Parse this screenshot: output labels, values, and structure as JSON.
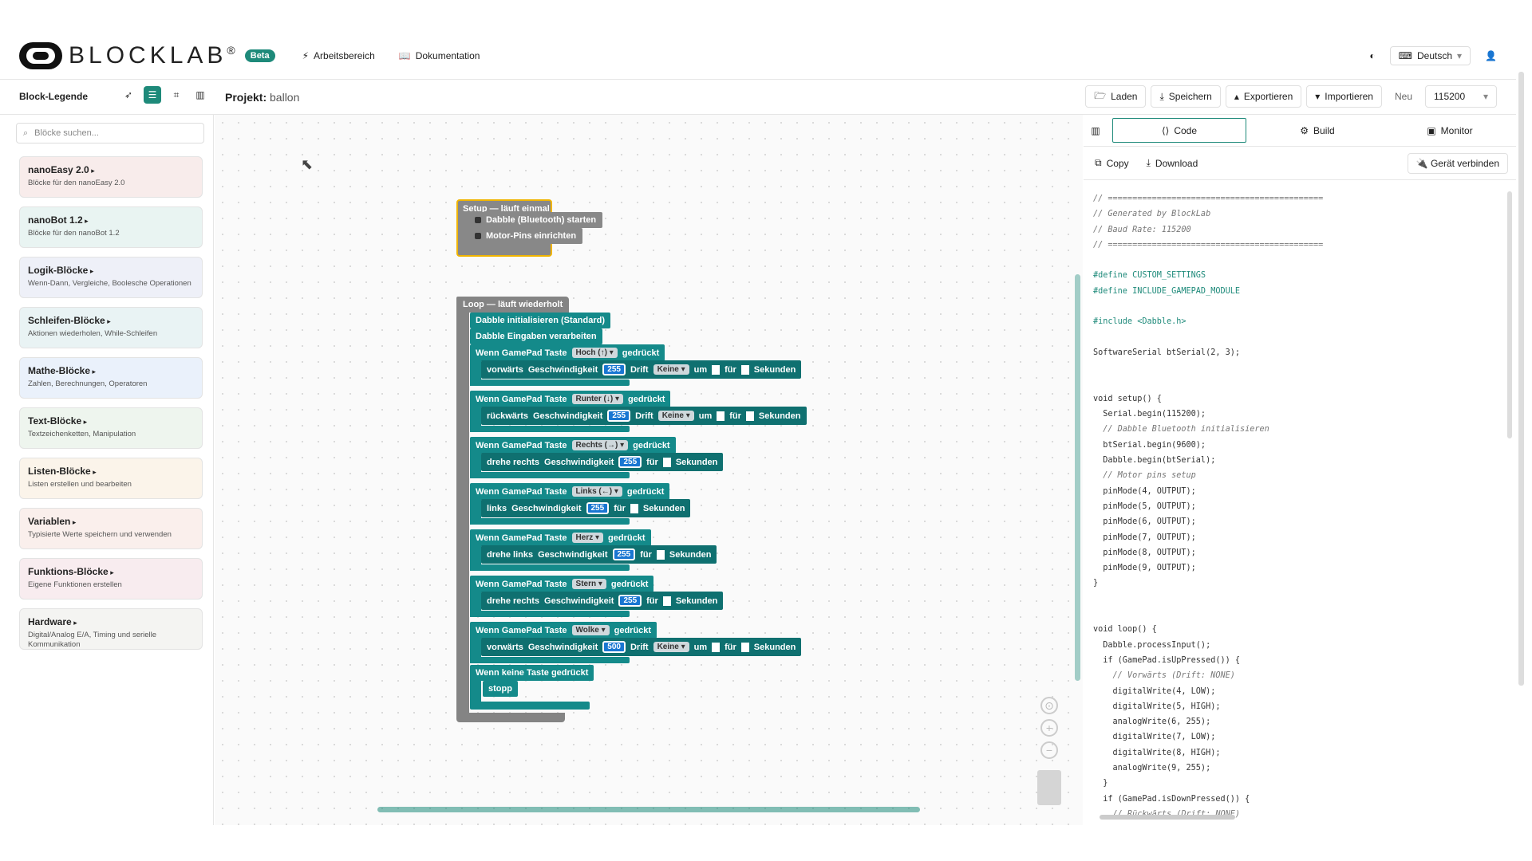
{
  "header": {
    "logo_text": "BLOCKLAB",
    "logo_mark": "®",
    "badge": "Beta",
    "nav": [
      {
        "icon": "bolt-icon",
        "label": "Arbeitsbereich"
      },
      {
        "icon": "book-icon",
        "label": "Dokumentation"
      }
    ],
    "language": "Deutsch"
  },
  "subbar": {
    "legend_title": "Block-Legende",
    "project_label": "Projekt:",
    "project_name": "ballon",
    "actions": {
      "load": "Laden",
      "save": "Speichern",
      "export": "Exportieren",
      "import": "Importieren",
      "new": "Neu",
      "baud": "115200"
    }
  },
  "sidebar": {
    "search_placeholder": "Blöcke suchen...",
    "categories": [
      {
        "title": "nanoEasy 2.0",
        "desc": "Blöcke für den nanoEasy 2.0",
        "color": "#f8eceb"
      },
      {
        "title": "nanoBot 1.2",
        "desc": "Blöcke für den nanoBot 1.2",
        "color": "#e9f4f2"
      },
      {
        "title": "Logik-Blöcke",
        "desc": "Wenn-Dann, Vergleiche, Boolesche Operationen",
        "color": "#eef0f8"
      },
      {
        "title": "Schleifen-Blöcke",
        "desc": "Aktionen wiederholen, While-Schleifen",
        "color": "#e9f3f4"
      },
      {
        "title": "Mathe-Blöcke",
        "desc": "Zahlen, Berechnungen, Operatoren",
        "color": "#eaf1fb"
      },
      {
        "title": "Text-Blöcke",
        "desc": "Textzeichenketten, Manipulation",
        "color": "#eef5ee"
      },
      {
        "title": "Listen-Blöcke",
        "desc": "Listen erstellen und bearbeiten",
        "color": "#fbf4ea"
      },
      {
        "title": "Variablen",
        "desc": "Typisierte Werte speichern und verwenden",
        "color": "#faefec"
      },
      {
        "title": "Funktions-Blöcke",
        "desc": "Eigene Funktionen erstellen",
        "color": "#f8ecef"
      },
      {
        "title": "Hardware",
        "desc": "Digital/Analog E/A, Timing und serielle Kommunikation",
        "color": "#f4f4f2"
      }
    ]
  },
  "workspace": {
    "setup_hat": "Setup — läuft einmal",
    "setup_blocks": [
      "Dabble (Bluetooth) starten",
      "Motor-Pins einrichten"
    ],
    "loop_hat": "Loop — läuft wiederholt",
    "loop_blocks": [
      "Dabble initialisieren (Standard)",
      "Dabble Eingaben verarbeiten"
    ],
    "when_prefix": "Wenn GamePad Taste",
    "when_suffix": "gedrückt",
    "speed_label": "Geschwindigkeit",
    "drift_label": "Drift",
    "drift_value": "Keine",
    "um_label": "um",
    "fuer_label": "für",
    "seconds_label": "Sekunden",
    "events": [
      {
        "button": "Hoch (↑)",
        "action": "vorwärts",
        "speed": "255",
        "drift": true
      },
      {
        "button": "Runter (↓)",
        "action": "rückwärts",
        "speed": "255",
        "drift": true
      },
      {
        "button": "Rechts (→)",
        "action": "drehe rechts",
        "speed": "255",
        "drift": false
      },
      {
        "button": "Links (←)",
        "action": "links",
        "speed": "255",
        "drift": false
      },
      {
        "button": "Herz",
        "action": "drehe links",
        "speed": "255",
        "drift": false
      },
      {
        "button": "Stern",
        "action": "drehe rechts",
        "speed": "255",
        "drift": false
      },
      {
        "button": "Wolke",
        "action": "vorwärts",
        "speed": "500",
        "drift": true
      }
    ],
    "no_key": "Wenn keine Taste gedrückt",
    "stop": "stopp"
  },
  "panel": {
    "tabs": [
      "Code",
      "Build",
      "Monitor"
    ],
    "copy": "Copy",
    "download": "Download",
    "connect": "Gerät verbinden"
  },
  "code_lines": [
    {
      "cls": "c",
      "text": "// ============================================"
    },
    {
      "cls": "c",
      "text": "// Generated by BlockLab"
    },
    {
      "cls": "c",
      "text": "// Baud Rate: 115200"
    },
    {
      "cls": "c",
      "text": "// ============================================"
    },
    {
      "cls": "",
      "text": ""
    },
    {
      "cls": "p",
      "text": "#define CUSTOM_SETTINGS"
    },
    {
      "cls": "p",
      "text": "#define INCLUDE_GAMEPAD_MODULE"
    },
    {
      "cls": "",
      "text": ""
    },
    {
      "cls": "p",
      "text": "#include <Dabble.h>"
    },
    {
      "cls": "",
      "text": ""
    },
    {
      "cls": "",
      "text": "SoftwareSerial btSerial(2, 3);"
    },
    {
      "cls": "",
      "text": ""
    },
    {
      "cls": "",
      "text": ""
    },
    {
      "cls": "",
      "text": "void setup() {"
    },
    {
      "cls": "",
      "text": "  Serial.begin(115200);"
    },
    {
      "cls": "c",
      "text": "  // Dabble Bluetooth initialisieren"
    },
    {
      "cls": "",
      "text": "  btSerial.begin(9600);"
    },
    {
      "cls": "",
      "text": "  Dabble.begin(btSerial);"
    },
    {
      "cls": "c",
      "text": "  // Motor pins setup"
    },
    {
      "cls": "",
      "text": "  pinMode(4, OUTPUT);"
    },
    {
      "cls": "",
      "text": "  pinMode(5, OUTPUT);"
    },
    {
      "cls": "",
      "text": "  pinMode(6, OUTPUT);"
    },
    {
      "cls": "",
      "text": "  pinMode(7, OUTPUT);"
    },
    {
      "cls": "",
      "text": "  pinMode(8, OUTPUT);"
    },
    {
      "cls": "",
      "text": "  pinMode(9, OUTPUT);"
    },
    {
      "cls": "",
      "text": "}"
    },
    {
      "cls": "",
      "text": ""
    },
    {
      "cls": "",
      "text": ""
    },
    {
      "cls": "",
      "text": "void loop() {"
    },
    {
      "cls": "",
      "text": "  Dabble.processInput();"
    },
    {
      "cls": "",
      "text": "  if (GamePad.isUpPressed()) {"
    },
    {
      "cls": "c",
      "text": "    // Vorwärts (Drift: NONE)"
    },
    {
      "cls": "",
      "text": "    digitalWrite(4, LOW);"
    },
    {
      "cls": "",
      "text": "    digitalWrite(5, HIGH);"
    },
    {
      "cls": "",
      "text": "    analogWrite(6, 255);"
    },
    {
      "cls": "",
      "text": "    digitalWrite(7, LOW);"
    },
    {
      "cls": "",
      "text": "    digitalWrite(8, HIGH);"
    },
    {
      "cls": "",
      "text": "    analogWrite(9, 255);"
    },
    {
      "cls": "",
      "text": "  }"
    },
    {
      "cls": "",
      "text": "  if (GamePad.isDownPressed()) {"
    },
    {
      "cls": "c",
      "text": "    // Rückwärts (Drift: NONE)"
    }
  ]
}
